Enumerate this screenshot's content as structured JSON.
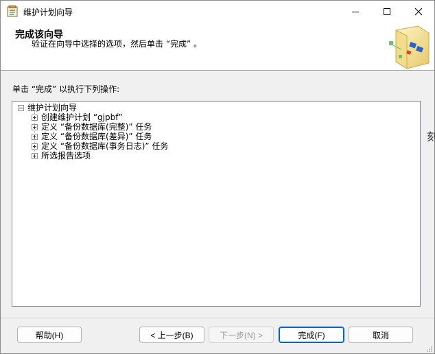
{
  "window": {
    "title": "维护计划向导",
    "icon": "wizard-app-icon",
    "controls": [
      "minimize-icon",
      "maximize-icon",
      "close-icon"
    ]
  },
  "header": {
    "title": "完成该向导",
    "subtitle": "验证在向导中选择的选项，然后单击 “完成” 。"
  },
  "instruction": "单击 “完成” 以执行下列操作:",
  "tree": {
    "root": {
      "label": "维护计划向导",
      "expanded": true
    },
    "children": [
      {
        "label": "创建维护计划 “gjpbf”",
        "expanded": false
      },
      {
        "label": "定义 “备份数据库(完整)” 任务",
        "expanded": false
      },
      {
        "label": "定义 “备份数据库(差异)” 任务",
        "expanded": false
      },
      {
        "label": "定义 “备份数据库(事务日志)” 任务",
        "expanded": false
      },
      {
        "label": "所选报告选项",
        "expanded": false
      }
    ]
  },
  "buttons": {
    "help": "帮助(H)",
    "prev": "< 上一步(B)",
    "next": "下一步(N) >",
    "finish": "完成(F)",
    "cancel": "取消"
  },
  "background_peek": "刻",
  "colors": {
    "accent": "#0067c0",
    "window_bg": "#f0f0f0",
    "disabled_text": "#9a9a9a"
  }
}
